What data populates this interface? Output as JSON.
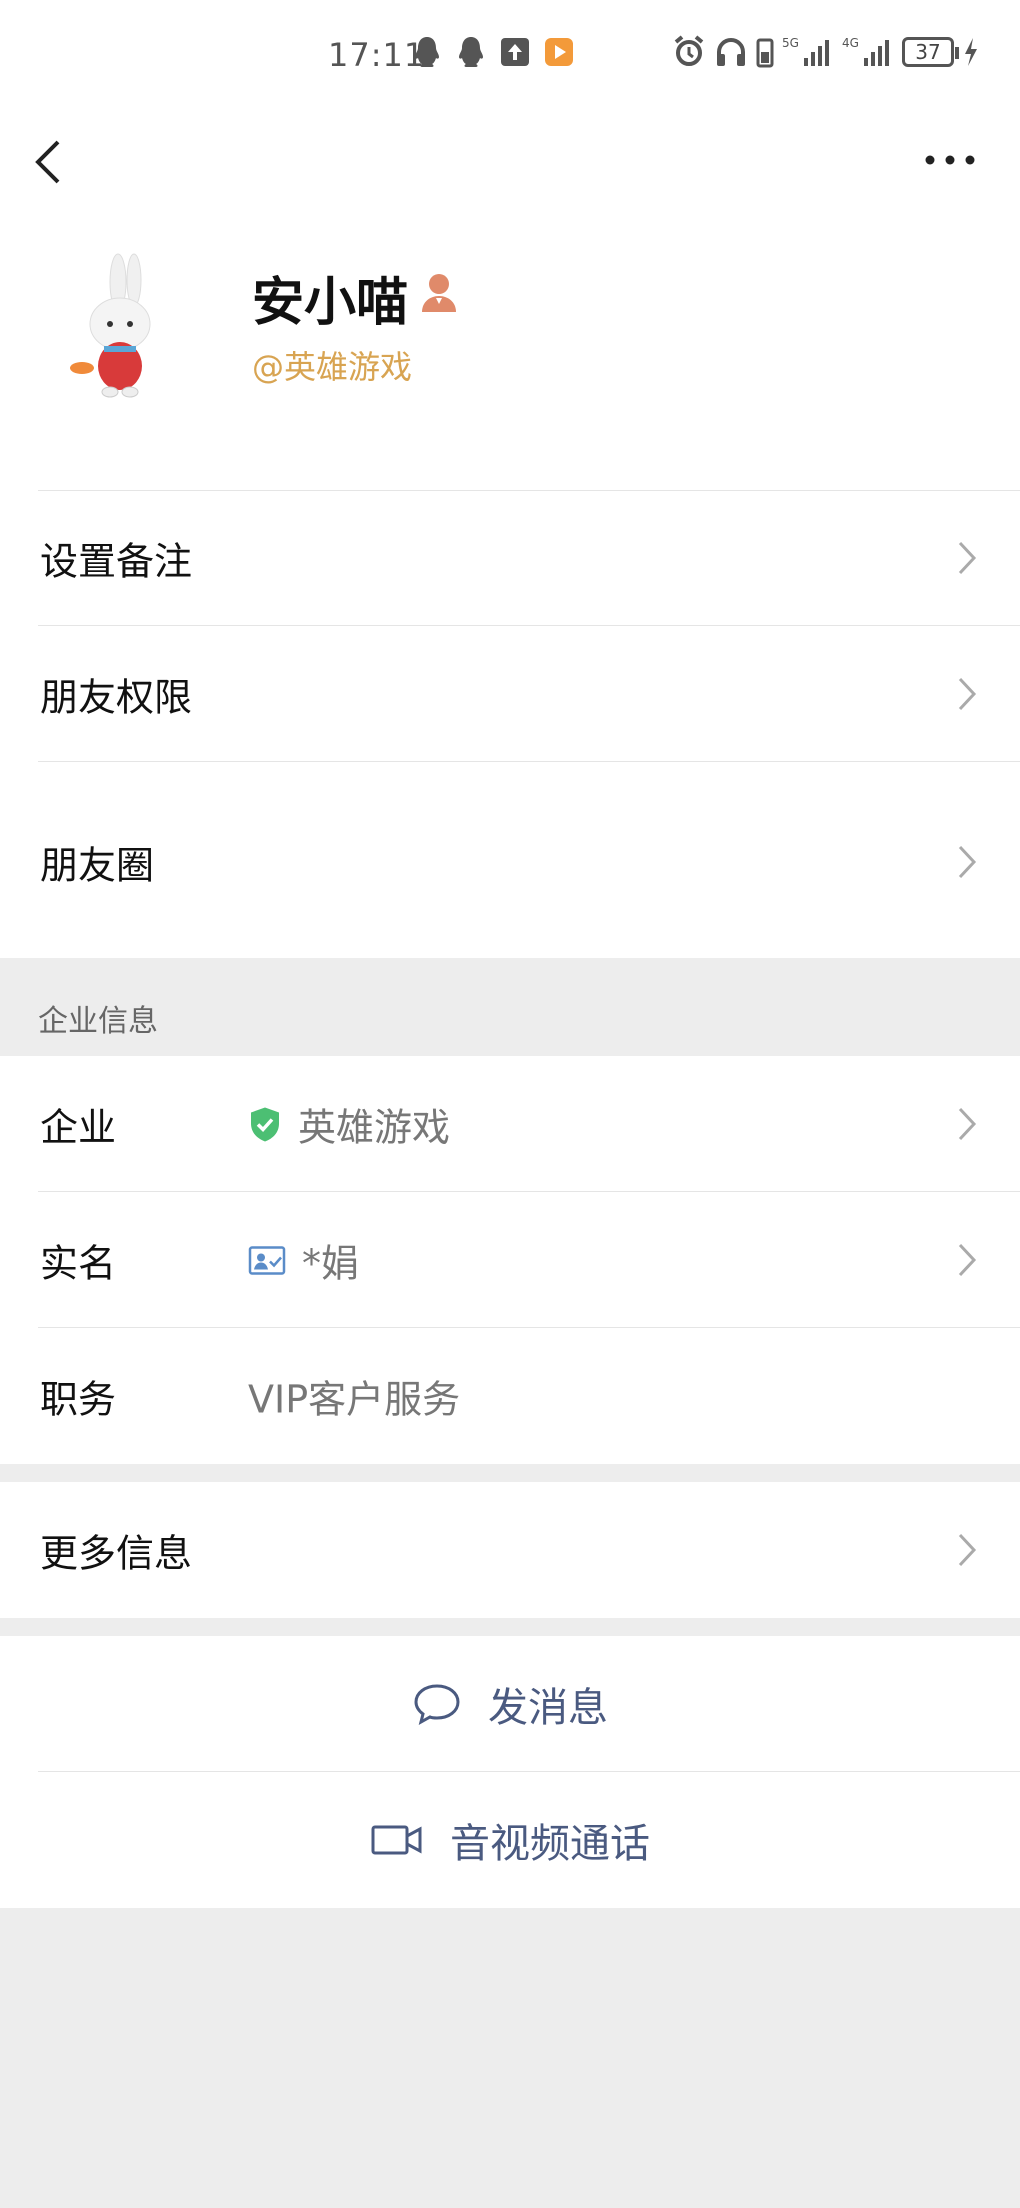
{
  "status_bar": {
    "time": "17:11",
    "battery": "37",
    "signal_labels": [
      "5G",
      "4G"
    ]
  },
  "profile": {
    "name": "安小喵",
    "org": "@英雄游戏"
  },
  "menu": {
    "remark": "设置备注",
    "permissions": "朋友权限",
    "moments": "朋友圈"
  },
  "enterprise": {
    "section_title": "企业信息",
    "company_label": "企业",
    "company_value": "英雄游戏",
    "realname_label": "实名",
    "realname_value": "*娟",
    "position_label": "职务",
    "position_value": "VIP客户服务"
  },
  "more": {
    "label": "更多信息"
  },
  "actions": {
    "message": "发消息",
    "call": "音视频通话"
  },
  "colors": {
    "background": "#ededed",
    "org_text": "#d8a452",
    "action_text": "#4a5a80",
    "verified_green": "#4cbf73"
  }
}
